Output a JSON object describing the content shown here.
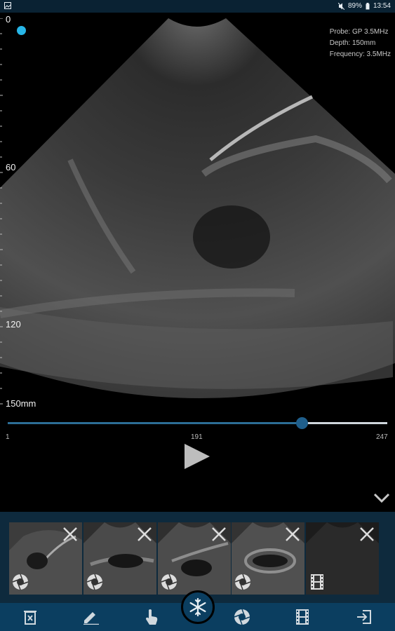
{
  "status_bar": {
    "battery": "89%",
    "time": "13:54"
  },
  "depth_scale": {
    "top": "0",
    "mid": "60",
    "lower": "120",
    "bottom": "150mm"
  },
  "probe_info": {
    "probe": "Probe: GP 3.5MHz",
    "depth": "Depth: 150mm",
    "frequency": "Frequency: 3.5MHz"
  },
  "cine": {
    "min": "1",
    "current": "191",
    "max": "247",
    "progress": 0.774
  },
  "thumbnails": [
    {
      "kind": "image"
    },
    {
      "kind": "image"
    },
    {
      "kind": "image"
    },
    {
      "kind": "image"
    },
    {
      "kind": "video"
    }
  ],
  "toolbar": {
    "items": [
      "delete-icon",
      "pencil-icon",
      "hand-pointer-icon",
      "snowflake-icon",
      "shutter-icon",
      "film-icon",
      "exit-icon"
    ]
  },
  "colors": {
    "accent": "#27b6e8",
    "bar": "#0b3e60",
    "strip": "#0e2a3d"
  }
}
